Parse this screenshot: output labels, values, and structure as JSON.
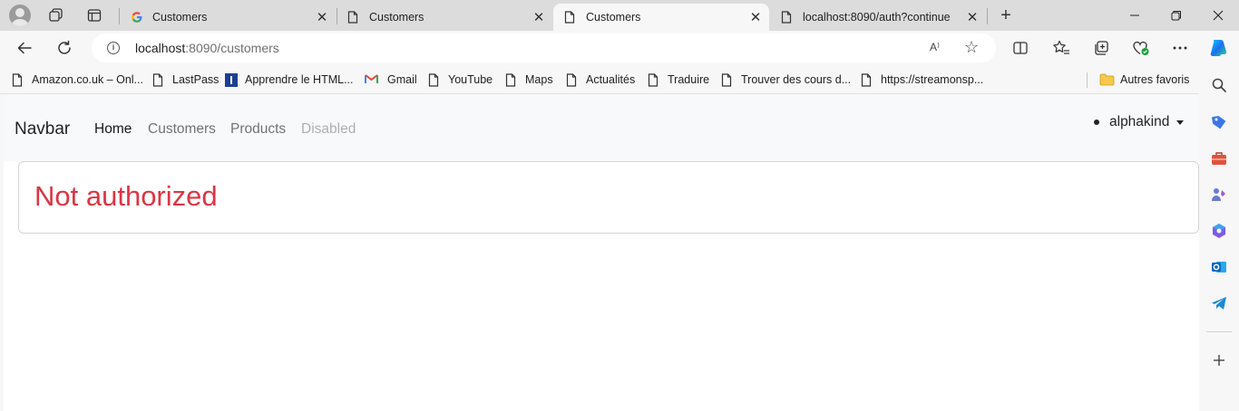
{
  "browser": {
    "tabs": [
      {
        "title": "Customers",
        "icon": "google-icon",
        "active": false
      },
      {
        "title": "Customers",
        "icon": "page-icon",
        "active": false
      },
      {
        "title": "Customers",
        "icon": "page-icon",
        "active": true
      },
      {
        "title": "localhost:8090/auth?continue",
        "icon": "page-icon",
        "active": false
      }
    ],
    "address": {
      "host": "localhost",
      "path": ":8090/customers"
    },
    "read_aloud_label": "A⁾",
    "bookmarks": [
      {
        "label": "Amazon.co.uk – Onl...",
        "icon": "page-icon"
      },
      {
        "label": "LastPass",
        "icon": "page-icon"
      },
      {
        "label": "Apprendre le HTML...",
        "icon": "i-logo-icon"
      },
      {
        "label": "Gmail",
        "icon": "gmail-icon"
      },
      {
        "label": "YouTube",
        "icon": "page-icon"
      },
      {
        "label": "Maps",
        "icon": "page-icon"
      },
      {
        "label": "Actualités",
        "icon": "page-icon"
      },
      {
        "label": "Traduire",
        "icon": "page-icon"
      },
      {
        "label": "Trouver des cours d...",
        "icon": "page-icon"
      },
      {
        "label": "https://streamonsp...",
        "icon": "page-icon"
      }
    ],
    "other_favorites": "Autres favoris",
    "colors": {
      "accent": "#0a7cd8",
      "tab_strip": "#dcdcdc",
      "toolbar": "#f7f7f7"
    }
  },
  "page": {
    "navbar": {
      "brand": "Navbar",
      "links": [
        {
          "label": "Home",
          "state": "active"
        },
        {
          "label": "Customers",
          "state": "normal"
        },
        {
          "label": "Products",
          "state": "normal"
        },
        {
          "label": "Disabled",
          "state": "disabled"
        }
      ],
      "user": "alphakind"
    },
    "alert": {
      "text": "Not authorized",
      "color": "#dc3545"
    }
  }
}
